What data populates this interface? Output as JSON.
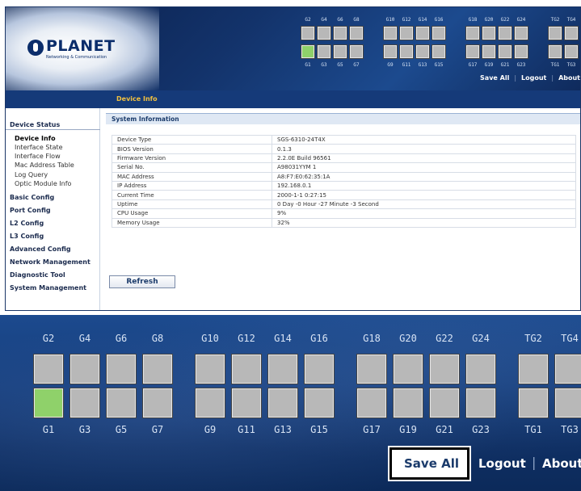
{
  "brand": {
    "name": "PLANET",
    "tagline": "Networking & Communication"
  },
  "ports": {
    "top_labels": [
      "G2",
      "G4",
      "G6",
      "G8",
      "G10",
      "G12",
      "G14",
      "G16",
      "G18",
      "G20",
      "G22",
      "G24",
      "TG2",
      "TG4"
    ],
    "bottom_labels": [
      "G1",
      "G3",
      "G5",
      "G7",
      "G9",
      "G11",
      "G13",
      "G15",
      "G17",
      "G19",
      "G21",
      "G23",
      "TG1",
      "TG3"
    ],
    "link_up": [
      "G1"
    ],
    "colors": {
      "up": "#8fd16a",
      "down": "#b8b8b8"
    }
  },
  "topnav": {
    "save_all": "Save All",
    "logout": "Logout",
    "about": "About"
  },
  "page_title": "Device Info",
  "menu": {
    "head": "Device Status",
    "status_items": [
      "Device Info",
      "Interface State",
      "Interface Flow",
      "Mac Address Table",
      "Log Query",
      "Optic Module Info"
    ],
    "active": "Device Info",
    "sections": [
      "Basic Config",
      "Port Config",
      "L2 Config",
      "L3 Config",
      "Advanced Config",
      "Network Management",
      "Diagnostic Tool",
      "System Management"
    ]
  },
  "system_info": {
    "title": "System Information",
    "rows": [
      {
        "key": "Device Type",
        "value": "SGS-6310-24T4X"
      },
      {
        "key": "BIOS Version",
        "value": "0.1.3"
      },
      {
        "key": "Firmware Version",
        "value": "2.2.0E Build 96561"
      },
      {
        "key": "Serial No.",
        "value": "A98031YYM 1"
      },
      {
        "key": "MAC Address",
        "value": "A8:F7:E0:62:35:1A"
      },
      {
        "key": "IP Address",
        "value": "192.168.0.1"
      },
      {
        "key": "Current Time",
        "value": "2000-1-1 0:27:15"
      },
      {
        "key": "Uptime",
        "value": "0 Day -0 Hour -27 Minute -3 Second"
      },
      {
        "key": "CPU Usage",
        "value": "9%"
      },
      {
        "key": "Memory Usage",
        "value": "32%"
      }
    ],
    "refresh_label": "Refresh"
  }
}
